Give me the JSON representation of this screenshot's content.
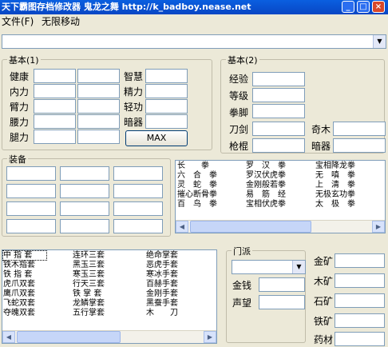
{
  "window": {
    "title": "天下霸图存档修改器 鬼龙之舞 http://k_badboy.nease.net",
    "min_icon": "_",
    "max_icon": "□",
    "close_icon": "×"
  },
  "menu": {
    "file": "文件(F)",
    "move": "无限移动"
  },
  "basic1": {
    "legend": "基本(1)",
    "labels": [
      "健康",
      "内力",
      "臂力",
      "腰力",
      "腿力"
    ],
    "labels_right": [
      "智慧",
      "精力",
      "轻功",
      "暗器"
    ],
    "max_button": "MAX"
  },
  "basic2": {
    "legend": "基本(2)",
    "labels": [
      "经验",
      "等级",
      "拳脚",
      "刀剑",
      "枪棍"
    ],
    "qimu": "奇木",
    "anqi": "暗器"
  },
  "equip": {
    "legend": "装备"
  },
  "skills_list": {
    "rows": [
      [
        "长　　拳",
        "罗　汉　拳",
        "宝相降龙拳"
      ],
      [
        "六　合　拳",
        "罗汉伏虎拳",
        "无　嗔　拳"
      ],
      [
        "灵　蛇　拳",
        "金刚般若拳",
        "上　清　拳"
      ],
      [
        "摧心断骨拳",
        "易　筋　经",
        "无极玄功拳"
      ],
      [
        "百　鸟　拳",
        "宝相伏虎拳",
        "太　极　拳"
      ]
    ]
  },
  "moves_list": {
    "rows": [
      [
        "中 指 套",
        "连环三套",
        "绝命掌套"
      ],
      [
        "铁木指套",
        "黑玉三套",
        "恶虎手套"
      ],
      [
        "铁 指 套",
        "寒玉三套",
        "寒冰手套"
      ],
      [
        "虎爪双套",
        "行天三套",
        "百赫手套"
      ],
      [
        "鹰爪双套",
        "铁 掌 套",
        "金刚手套"
      ],
      [
        "飞蛇双套",
        "龙鳞掌套",
        "黑蚕手套"
      ],
      [
        "夺魄双套",
        "五行掌套",
        "木　　刀"
      ]
    ]
  },
  "sect": {
    "legend": "门派",
    "money": "金钱",
    "fame": "声望",
    "ores": [
      "金矿",
      "木矿",
      "石矿",
      "铁矿",
      "药材"
    ]
  },
  "icons": {
    "dropdown": "chevron-down-icon",
    "left": "arrow-left-icon",
    "right": "arrow-right-icon"
  }
}
